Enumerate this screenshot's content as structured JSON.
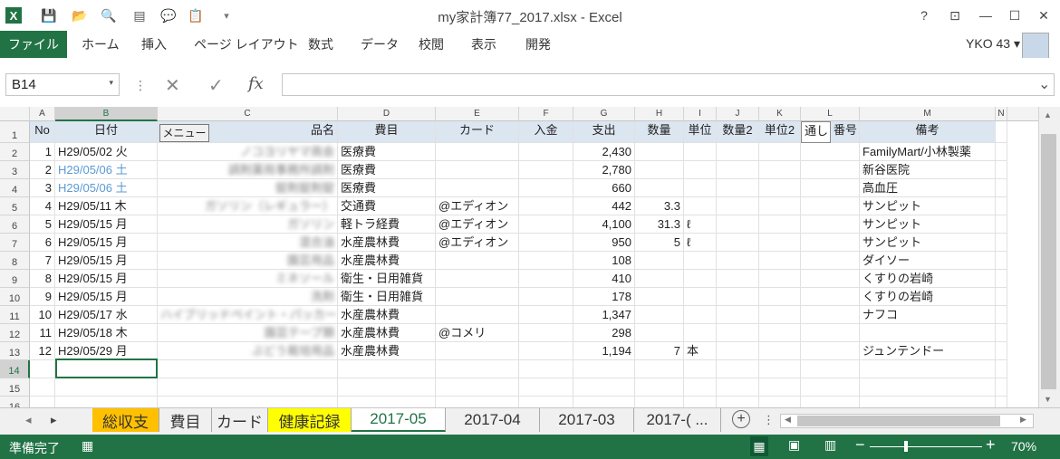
{
  "window": {
    "title": "my家計簿77_2017.xlsx - Excel",
    "help": "?",
    "ribbon_display": "⊡",
    "minimize": "—",
    "maximize": "☐",
    "close": "✕"
  },
  "quick_access": {
    "more": "▾"
  },
  "ribbon": {
    "file": "ファイル",
    "tabs": [
      "ホーム",
      "挿入",
      "ページ レイアウト",
      "数式",
      "データ",
      "校閲",
      "表示",
      "開発"
    ],
    "user": "YKO 43"
  },
  "formula_bar": {
    "name_box": "B14",
    "cancel": "✕",
    "enter": "✓",
    "fx": "fx",
    "value": "",
    "expand": "⌄"
  },
  "columns": [
    "A",
    "B",
    "C",
    "D",
    "E",
    "F",
    "G",
    "H",
    "I",
    "J",
    "K",
    "L",
    "M",
    "N"
  ],
  "header_row": {
    "no": "No",
    "date": "日付",
    "menu_button": "メニュー",
    "item": "品名",
    "category": "費目",
    "card": "カード",
    "income": "入金",
    "expense": "支出",
    "qty": "数量",
    "unit": "単位",
    "qty2": "数量2",
    "unit2": "単位2",
    "tsushi": "通し",
    "bangou": "番号",
    "note": "備考"
  },
  "rows": [
    {
      "row": "2",
      "no": "1",
      "date": "H29/05/02 火",
      "item": "ノコヨリヤマ商会",
      "cat": "医療費",
      "card": "",
      "exp": "2,430",
      "qty": "",
      "unit": "",
      "note": "FamilyMart/小林製薬",
      "blue": false
    },
    {
      "row": "3",
      "no": "2",
      "date": "H29/05/06 土",
      "item": "調剤薬局事務所調剤",
      "cat": "医療費",
      "card": "",
      "exp": "2,780",
      "qty": "",
      "unit": "",
      "note": "新谷医院",
      "blue": true
    },
    {
      "row": "4",
      "no": "3",
      "date": "H29/05/06 土",
      "item": "錠剤錠剤錠",
      "cat": "医療費",
      "card": "",
      "exp": "660",
      "qty": "",
      "unit": "",
      "note": "高血圧",
      "blue": true
    },
    {
      "row": "5",
      "no": "4",
      "date": "H29/05/11 木",
      "item": "ガソリン（レギュラー）",
      "cat": "交通費",
      "card": "@エディオン",
      "exp": "442",
      "qty": "3.3",
      "unit": "",
      "note": "サンピット",
      "blue": false
    },
    {
      "row": "6",
      "no": "5",
      "date": "H29/05/15 月",
      "item": "ガソリン",
      "cat": "軽トラ経費",
      "card": "@エディオン",
      "exp": "4,100",
      "qty": "31.3",
      "unit": "ℓ",
      "note": "サンピット",
      "blue": false
    },
    {
      "row": "7",
      "no": "6",
      "date": "H29/05/15 月",
      "item": "混合油",
      "cat": "水産農林費",
      "card": "@エディオン",
      "exp": "950",
      "qty": "5",
      "unit": "ℓ",
      "note": "サンピット",
      "blue": false
    },
    {
      "row": "8",
      "no": "7",
      "date": "H29/05/15 月",
      "item": "園芸用品",
      "cat": "水産農林費",
      "card": "",
      "exp": "108",
      "qty": "",
      "unit": "",
      "note": "ダイソー",
      "blue": false
    },
    {
      "row": "9",
      "no": "8",
      "date": "H29/05/15 月",
      "item": "ミネソール",
      "cat": "衛生・日用雑貨",
      "card": "",
      "exp": "410",
      "qty": "",
      "unit": "",
      "note": "くすりの岩崎",
      "blue": false
    },
    {
      "row": "10",
      "no": "9",
      "date": "H29/05/15 月",
      "item": "洗剤",
      "cat": "衛生・日用雑貨",
      "card": "",
      "exp": "178",
      "qty": "",
      "unit": "",
      "note": "くすりの岩崎",
      "blue": false
    },
    {
      "row": "11",
      "no": "10",
      "date": "H29/05/17 水",
      "item": "ハイブリッドペイント・パッカー",
      "cat": "水産農林費",
      "card": "",
      "exp": "1,347",
      "qty": "",
      "unit": "",
      "note": "ナフコ",
      "blue": false
    },
    {
      "row": "12",
      "no": "11",
      "date": "H29/05/18 木",
      "item": "園芸テープ類",
      "cat": "水産農林費",
      "card": "@コメリ",
      "exp": "298",
      "qty": "",
      "unit": "",
      "note": "",
      "blue": false
    },
    {
      "row": "13",
      "no": "12",
      "date": "H29/05/29 月",
      "item": "ぶどう栽培用品",
      "cat": "水産農林費",
      "card": "",
      "exp": "1,194",
      "qty": "7",
      "unit": "本",
      "note": "ジュンテンドー",
      "blue": false
    }
  ],
  "empty_rows": [
    "14",
    "15",
    "16"
  ],
  "sheet_tabs": [
    {
      "label": "総収支",
      "style": "orange"
    },
    {
      "label": "費目",
      "style": ""
    },
    {
      "label": "カード",
      "style": ""
    },
    {
      "label": "健康記録",
      "style": "yellow"
    },
    {
      "label": "2017-05",
      "style": "active"
    },
    {
      "label": "2017-04",
      "style": ""
    },
    {
      "label": "2017-03",
      "style": ""
    },
    {
      "label": "2017-( ...",
      "style": ""
    }
  ],
  "sheet_nav": {
    "prev": "◂",
    "next": "▸",
    "add": "+",
    "more": "⋮"
  },
  "status_bar": {
    "ready": "準備完了",
    "zoom": "70%",
    "minus": "−",
    "plus": "+"
  },
  "colors": {
    "accent": "#217346",
    "header_fill": "#dce6f1",
    "tab_yellow": "#ffff00",
    "tab_orange": "#ffc000",
    "date_blue": "#5b9bd5"
  }
}
